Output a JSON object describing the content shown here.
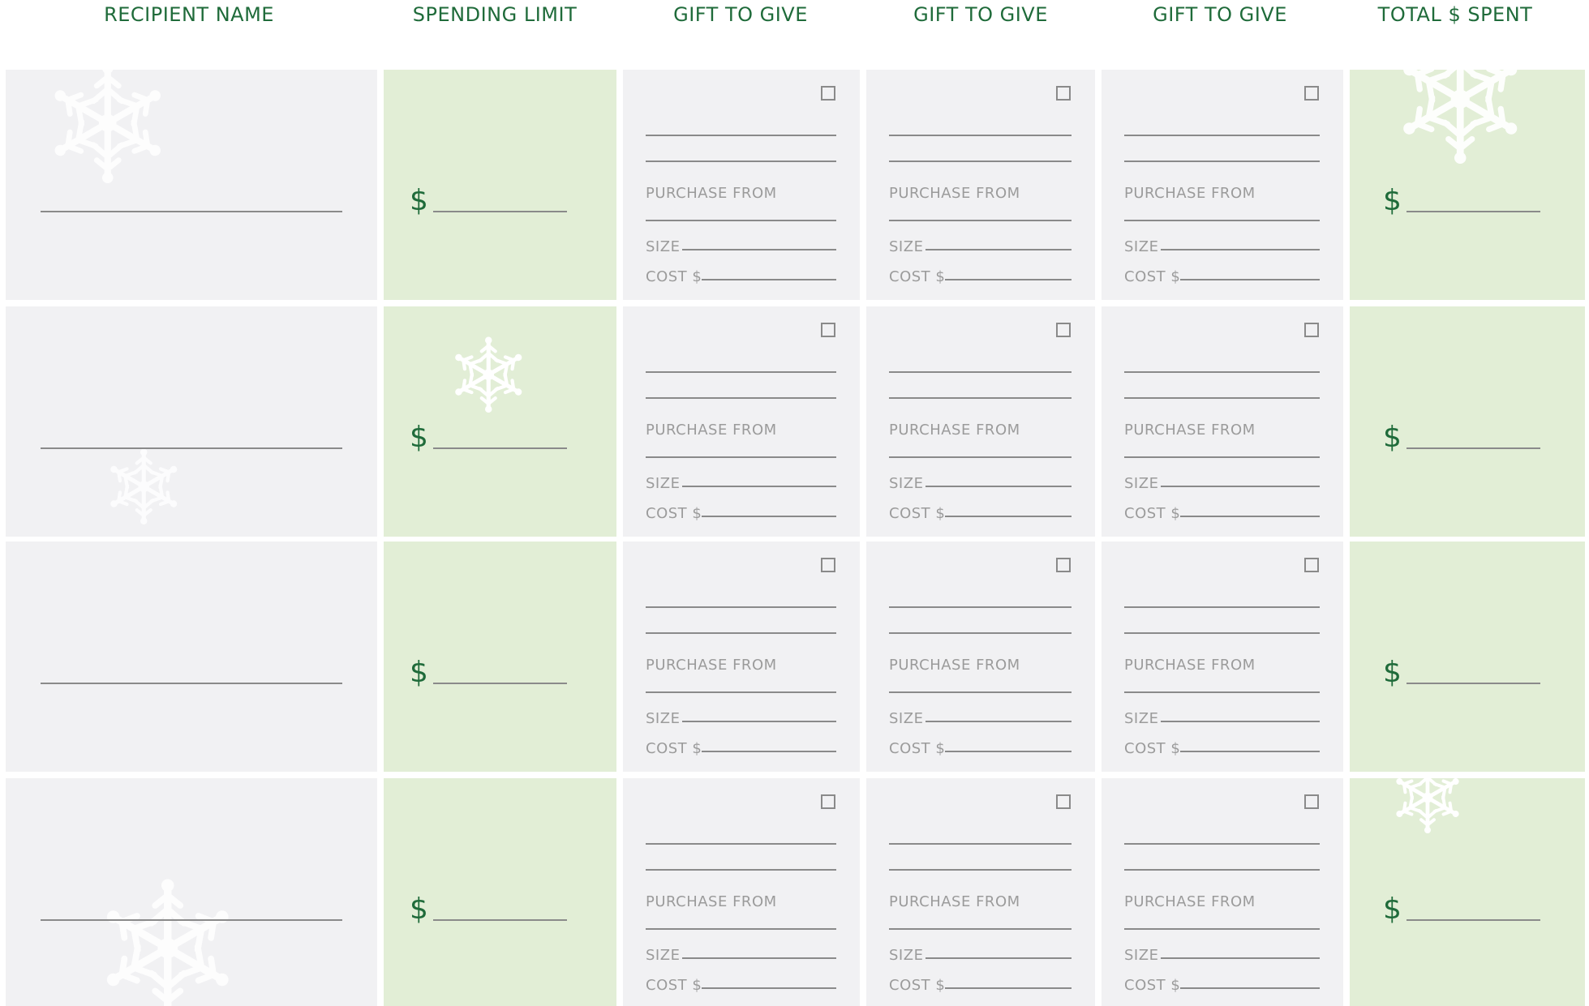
{
  "headers": {
    "recipient": "RECIPIENT NAME",
    "limit": "SPENDING LIMIT",
    "gift1": "GIFT TO GIVE",
    "gift2": "GIFT TO GIVE",
    "gift3": "GIFT TO GIVE",
    "total": "TOTAL $ SPENT"
  },
  "labels": {
    "currency": "$",
    "purchase_from": "PURCHASE FROM",
    "size": "SIZE",
    "cost": "COST $"
  },
  "row_count": 4,
  "gifts_per_row": 3,
  "colors": {
    "header_green": "#1f6b3a",
    "dollar_green": "#1f6b3a",
    "gray_cell": "#f1f1f3",
    "green_cell": "#e2eed6",
    "rule_line": "#8a8a8a",
    "label_gray": "#9b9b9b",
    "snowflake": "#ffffff"
  },
  "icons": {
    "decoration": "snowflake-icon",
    "checkbox": "checkbox-icon"
  }
}
